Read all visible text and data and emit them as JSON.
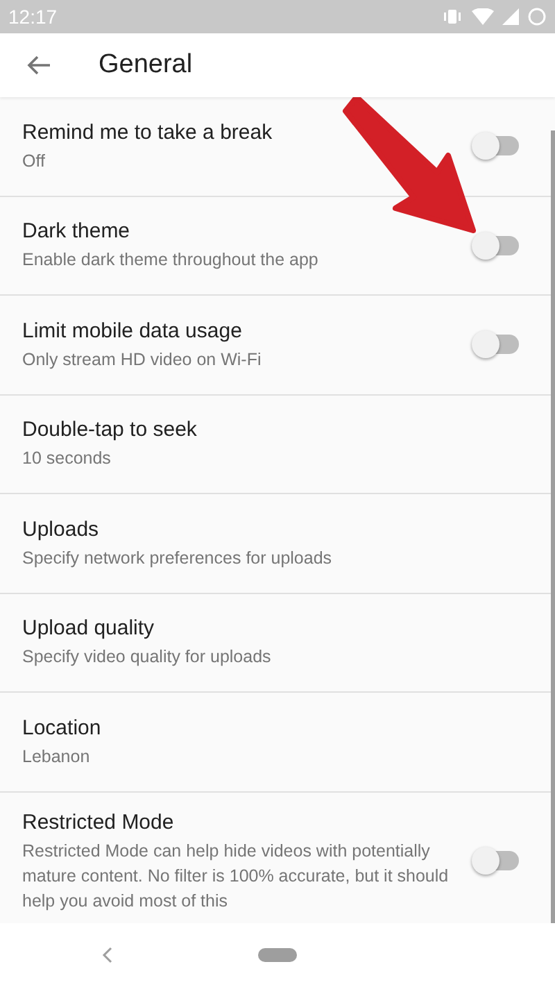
{
  "status_bar": {
    "time": "12:17"
  },
  "header": {
    "title": "General"
  },
  "settings": [
    {
      "kind": "toggle",
      "title": "Remind me to take a break",
      "subtitle": "Off",
      "on": false
    },
    {
      "kind": "toggle",
      "title": "Dark theme",
      "subtitle": "Enable dark theme throughout the app",
      "on": false
    },
    {
      "kind": "toggle",
      "title": "Limit mobile data usage",
      "subtitle": "Only stream HD video on Wi-Fi",
      "on": false
    },
    {
      "kind": "plain",
      "title": "Double-tap to seek",
      "subtitle": "10 seconds"
    },
    {
      "kind": "plain",
      "title": "Uploads",
      "subtitle": "Specify network preferences for uploads"
    },
    {
      "kind": "plain",
      "title": "Upload quality",
      "subtitle": "Specify video quality for uploads"
    },
    {
      "kind": "plain",
      "title": "Location",
      "subtitle": "Lebanon"
    },
    {
      "kind": "toggle",
      "title": "Restricted Mode",
      "subtitle": "Restricted Mode can help hide videos with potentially mature content. No filter is 100% accurate, but it should help you avoid most of this",
      "on": false
    }
  ]
}
